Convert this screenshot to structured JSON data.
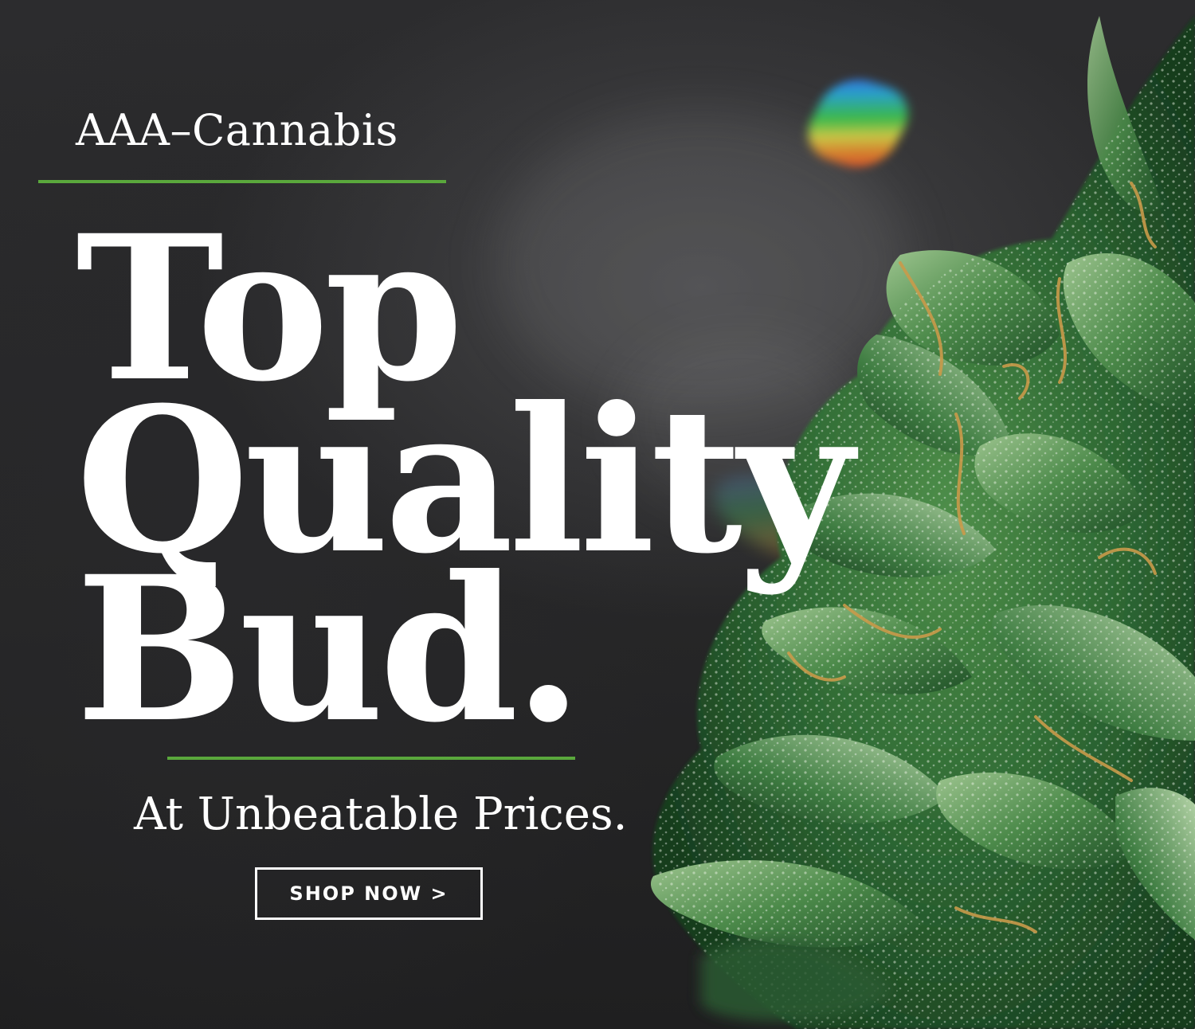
{
  "brand": {
    "name": "AAA–Cannabis"
  },
  "headline": {
    "line1": "Top",
    "line2": "Quality",
    "line3": "Bud."
  },
  "tagline": "At Unbeatable Prices.",
  "cta": {
    "label": "SHOP NOW >"
  },
  "colors": {
    "accent": "#5aa83c",
    "text": "#ffffff",
    "background": "#2a2a2b"
  },
  "imagery": {
    "photo_subject": "cannabis-bud-photo"
  }
}
